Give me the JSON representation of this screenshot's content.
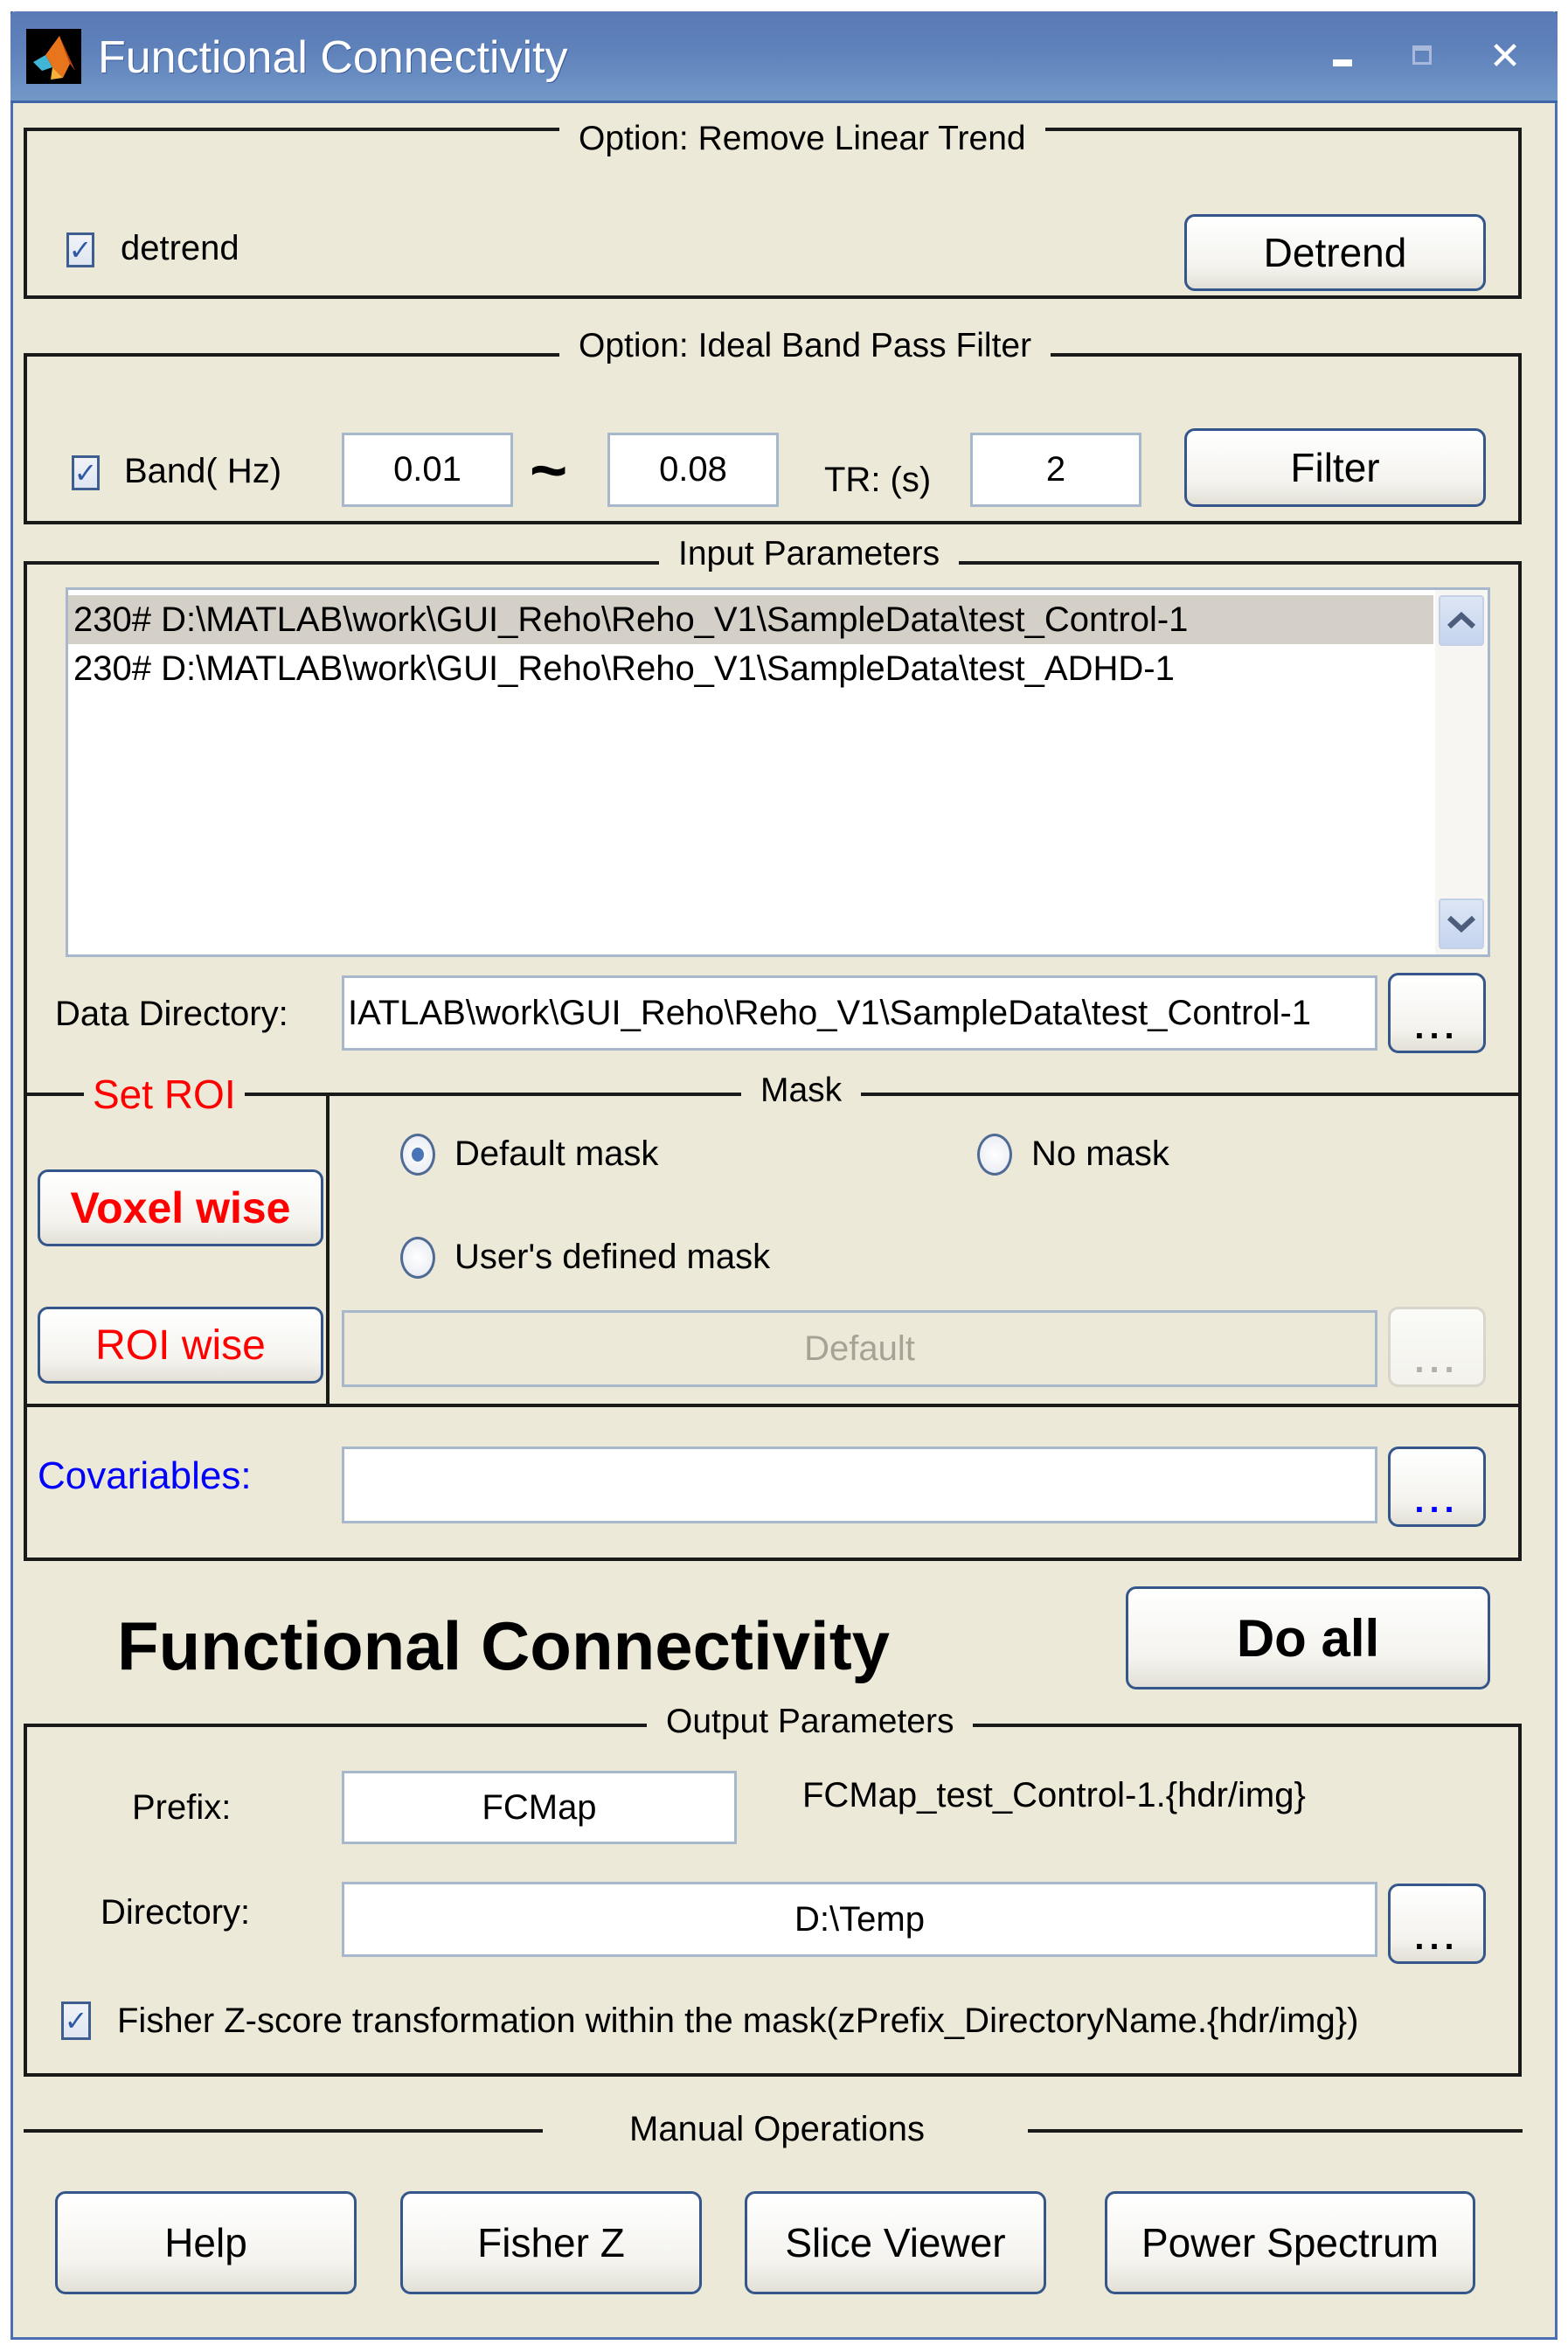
{
  "window": {
    "title": "Functional Connectivity",
    "icon": "matlab-logo-icon",
    "controls": {
      "minimize": "_",
      "maximize": "□",
      "close": "✕"
    }
  },
  "detrend_panel": {
    "title": "Option: Remove Linear Trend",
    "checkbox_label": "detrend",
    "checkbox_checked": true,
    "button_label": "Detrend"
  },
  "filter_panel": {
    "title": "Option: Ideal Band Pass Filter",
    "checkbox_label": "Band( Hz)",
    "checkbox_checked": true,
    "band_low": "0.01",
    "tilde": "~",
    "band_high": "0.08",
    "tr_label": "TR: (s)",
    "tr_value": "2",
    "button_label": "Filter"
  },
  "input_panel": {
    "title": "Input Parameters",
    "list_items": [
      {
        "text": "230# D:\\MATLAB\\work\\GUI_Reho\\Reho_V1\\SampleData\\test_Control-1",
        "selected": true
      },
      {
        "text": "230# D:\\MATLAB\\work\\GUI_Reho\\Reho_V1\\SampleData\\test_ADHD-1",
        "selected": false
      }
    ],
    "scroll_up": "^",
    "scroll_down": "v",
    "data_dir_label": "Data Directory:",
    "data_dir_value": "IATLAB\\work\\GUI_Reho\\Reho_V1\\SampleData\\test_Control-1",
    "browse_label": "..."
  },
  "roi_panel": {
    "title": "Set ROI",
    "voxel_wise_label": "Voxel wise",
    "roi_wise_label": "ROI wise"
  },
  "mask_panel": {
    "title": "Mask",
    "options": [
      {
        "label": "Default mask",
        "selected": true
      },
      {
        "label": "No mask",
        "selected": false
      },
      {
        "label": "User's defined mask",
        "selected": false
      }
    ],
    "mask_file_value": "Default",
    "browse_label": "..."
  },
  "covariables": {
    "label": "Covariables:",
    "value": "",
    "browse_label": "..."
  },
  "main": {
    "heading": "Functional Connectivity",
    "do_all_label": "Do all"
  },
  "output_panel": {
    "title": "Output Parameters",
    "prefix_label": "Prefix:",
    "prefix_value": "FCMap",
    "output_filename": "FCMap_test_Control-1.{hdr/img}",
    "directory_label": "Directory:",
    "directory_value": "D:\\Temp",
    "browse_label": "...",
    "fisher_checked": true,
    "fisher_label": "Fisher Z-score transformation within the mask(zPrefix_DirectoryName.{hdr/img})"
  },
  "manual_ops": {
    "title": "Manual Operations",
    "buttons": [
      "Help",
      "Fisher Z",
      "Slice Viewer",
      "Power Spectrum"
    ]
  },
  "colors": {
    "titlebar": "#5a7ab6",
    "background": "#ece9d8",
    "roi_text": "#ff0000",
    "covariables_text": "#0000ff"
  }
}
